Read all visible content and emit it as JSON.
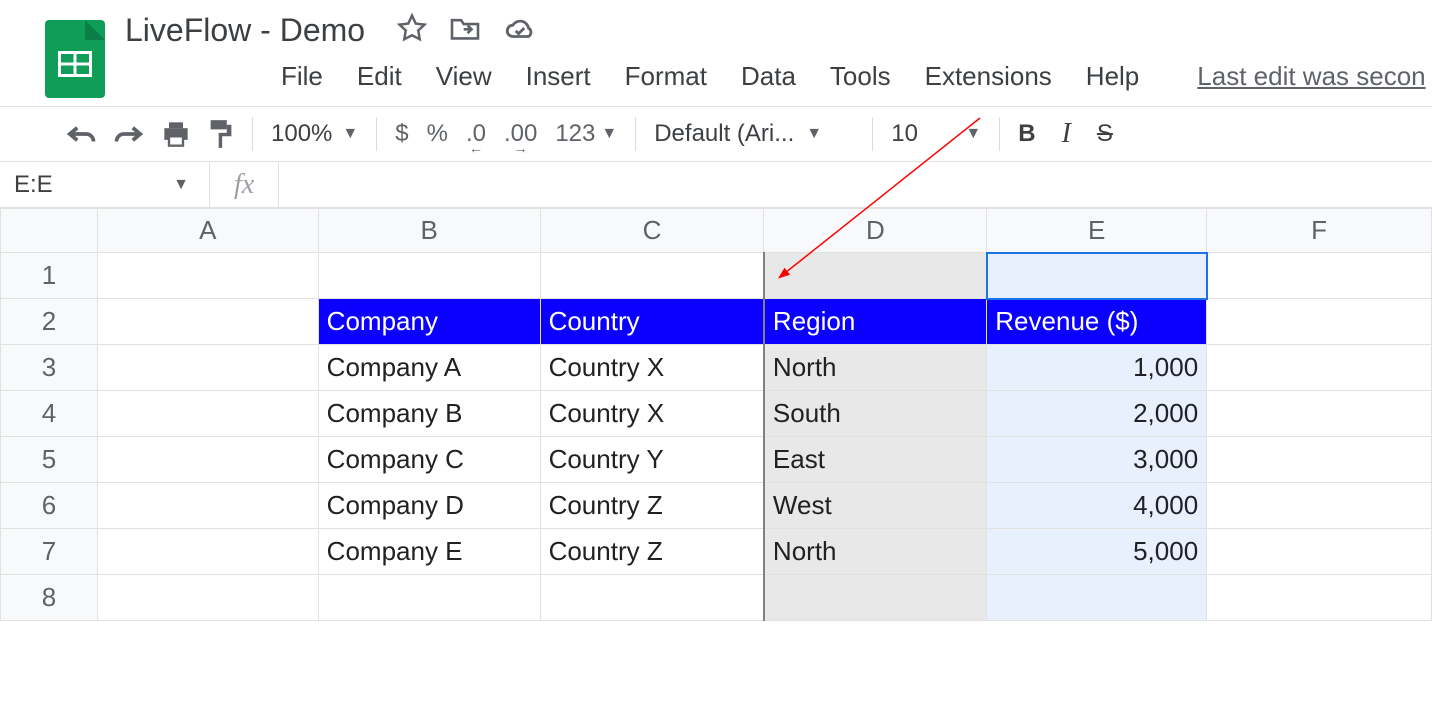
{
  "header": {
    "title": "LiveFlow - Demo",
    "menus": [
      "File",
      "Edit",
      "View",
      "Insert",
      "Format",
      "Data",
      "Tools",
      "Extensions",
      "Help"
    ],
    "last_edit": "Last edit was secon"
  },
  "toolbar": {
    "zoom": "100%",
    "currency": "$",
    "percent": "%",
    "dec_dec": ".0",
    "inc_dec": ".00",
    "numfmt": "123",
    "font": "Default (Ari...",
    "font_size": "10",
    "bold": "B",
    "italic": "I",
    "strike": "S"
  },
  "namebox": "E:E",
  "columns": [
    "A",
    "B",
    "C",
    "D",
    "E",
    "F"
  ],
  "rows": [
    "1",
    "2",
    "3",
    "4",
    "5",
    "6",
    "7",
    "8"
  ],
  "table": {
    "headers": {
      "company": "Company",
      "country": "Country",
      "region": "Region",
      "revenue": "Revenue ($)"
    },
    "rows": [
      {
        "company": "Company A",
        "country": "Country X",
        "region": "North",
        "revenue": "1,000"
      },
      {
        "company": "Company B",
        "country": "Country X",
        "region": "South",
        "revenue": "2,000"
      },
      {
        "company": "Company C",
        "country": "Country Y",
        "region": "East",
        "revenue": "3,000"
      },
      {
        "company": "Company D",
        "country": "Country Z",
        "region": "West",
        "revenue": "4,000"
      },
      {
        "company": "Company E",
        "country": "Country Z",
        "region": "North",
        "revenue": "5,000"
      }
    ]
  }
}
